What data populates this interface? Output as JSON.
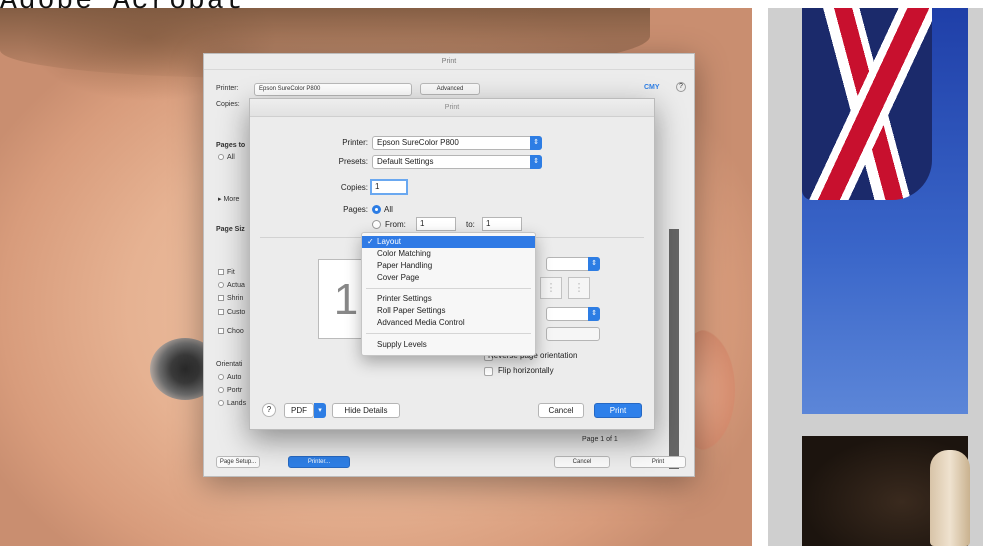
{
  "app_title": "Adobe Acrobat",
  "back_dialog": {
    "title": "Print",
    "printer_label": "Printer:",
    "printer_value": "Epson SureColor P800",
    "advanced_button": "Advanced",
    "help_icon_label": "?",
    "ink_label": "CMY",
    "copies_label": "Copies:",
    "pages_label": "Pages to",
    "all_option": "All",
    "more_option": "More",
    "page_sizing_label": "Page Siz",
    "fit_option": "Fit",
    "actual_option": "Actua",
    "shrink_option": "Shrin",
    "custom_option": "Custo",
    "choose_option": "Choo",
    "orientation_label": "Orientati",
    "auto_option": "Auto",
    "portrait_option": "Portr",
    "landscape_option": "Lands",
    "page_count": "Page 1 of 1",
    "page_setup_button": "Page Setup...",
    "printer_button": "Printer...",
    "cancel_button": "Cancel",
    "print_button": "Print"
  },
  "front_dialog": {
    "title": "Print",
    "printer_label": "Printer:",
    "printer_value": "Epson SureColor P800",
    "presets_label": "Presets:",
    "presets_value": "Default Settings",
    "copies_label": "Copies:",
    "copies_value": "1",
    "pages_label": "Pages:",
    "all_label": "All",
    "from_label": "From:",
    "from_value": "1",
    "to_label": "to:",
    "to_value": "1",
    "preview_page_number": "1",
    "reverse_orientation": "Reverse page orientation",
    "flip_horizontally": "Flip horizontally",
    "help_label": "?",
    "pdf_button": "PDF",
    "hide_details_button": "Hide Details",
    "cancel_button": "Cancel",
    "print_button": "Print"
  },
  "menu": {
    "items": [
      {
        "label": "Layout",
        "selected": true
      },
      {
        "label": "Color Matching"
      },
      {
        "label": "Paper Handling"
      },
      {
        "label": "Cover Page"
      },
      {
        "label": "Printer Settings"
      },
      {
        "label": "Roll Paper Settings"
      },
      {
        "label": "Advanced Media Control"
      },
      {
        "label": "Supply Levels"
      }
    ]
  },
  "colors": {
    "accent": "#2e7fe6",
    "dialog_bg": "#ececec"
  }
}
